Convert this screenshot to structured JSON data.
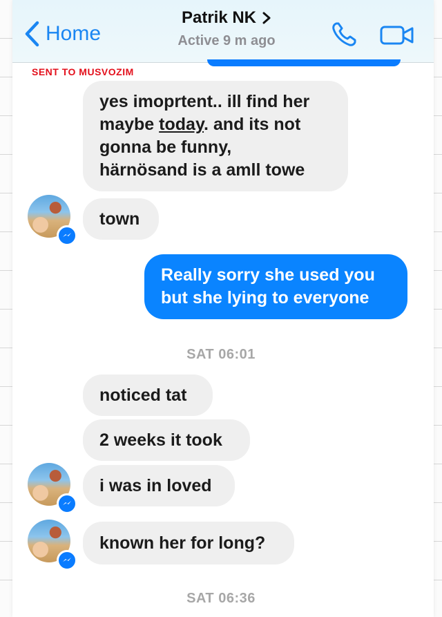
{
  "header": {
    "back_label": "Home",
    "contact_name": "Patrik NK",
    "status": "Active 9 m ago",
    "accent_color": "#1a86f2"
  },
  "watermark": "SENT TO MUSVOZIM",
  "messages": [
    {
      "direction": "incoming",
      "lines": [
        "yes imoprtent.. ill find her",
        "maybe ",
        "today",
        ". and its not",
        "gonna be funny,",
        "härnösand is a amll towe"
      ]
    },
    {
      "direction": "incoming",
      "text": "town"
    },
    {
      "direction": "outgoing",
      "lines": [
        "Really sorry she used you",
        "but she lying to everyone"
      ]
    },
    {
      "type": "timestamp",
      "text": "SAT 06:01"
    },
    {
      "direction": "incoming",
      "text": "noticed tat"
    },
    {
      "direction": "incoming",
      "text": "2 weeks it took"
    },
    {
      "direction": "incoming",
      "text": "i was in loved"
    },
    {
      "direction": "incoming",
      "text": "known her for long?"
    },
    {
      "type": "timestamp",
      "text": "SAT 06:36"
    }
  ],
  "colors": {
    "outgoing_bubble": "#0a84ff",
    "incoming_bubble": "#efefef",
    "watermark": "#e3101c"
  },
  "icons": {
    "back": "chevron-left-icon",
    "call": "phone-icon",
    "video": "video-camera-icon",
    "badge": "messenger-badge-icon"
  }
}
